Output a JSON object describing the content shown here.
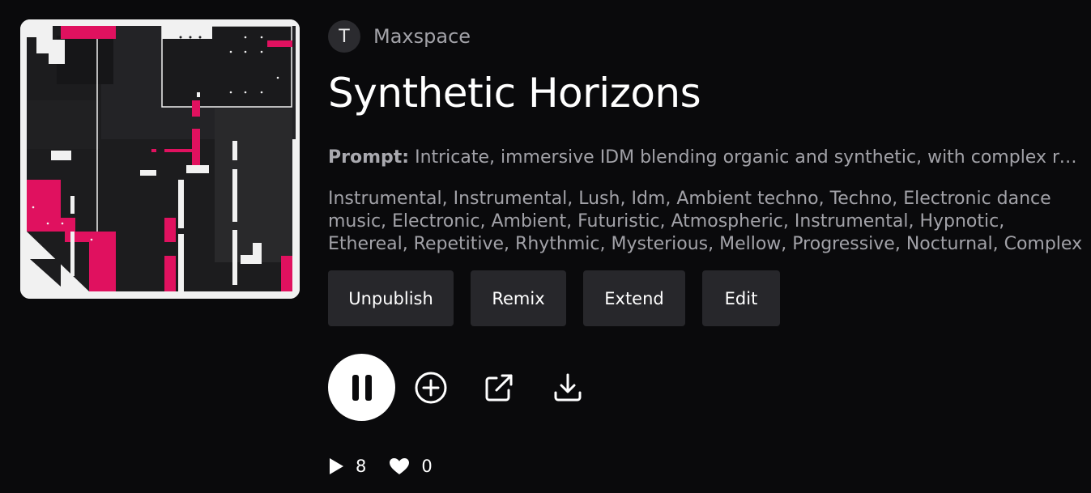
{
  "artist": {
    "avatar_letter": "T",
    "name": "Maxspace"
  },
  "song": {
    "title": "Synthetic Horizons",
    "prompt_label": "Prompt:",
    "prompt_text": "Intricate, immersive IDM blending organic and synthetic, with complex rhythmic patterns and evolving textures",
    "tags": "Instrumental, Instrumental, Lush, Idm, Ambient techno, Techno, Electronic dance music, Electronic, Ambient, Futuristic, Atmospheric, Instrumental, Hypnotic, Ethereal, Repetitive, Rhythmic, Mysterious, Mellow, Progressive, Nocturnal, Complex"
  },
  "actions": {
    "unpublish": "Unpublish",
    "remix": "Remix",
    "extend": "Extend",
    "edit": "Edit"
  },
  "controls": {
    "play_state_icon": "pause-icon",
    "add_icon": "plus-circle-icon",
    "share_icon": "external-link-icon",
    "download_icon": "download-icon"
  },
  "stats": {
    "plays": "8",
    "likes": "0"
  },
  "colors": {
    "background": "#0a0a0c",
    "accent": "#e0115f",
    "button_bg": "#27272b",
    "muted_text": "#a2a2a8"
  }
}
